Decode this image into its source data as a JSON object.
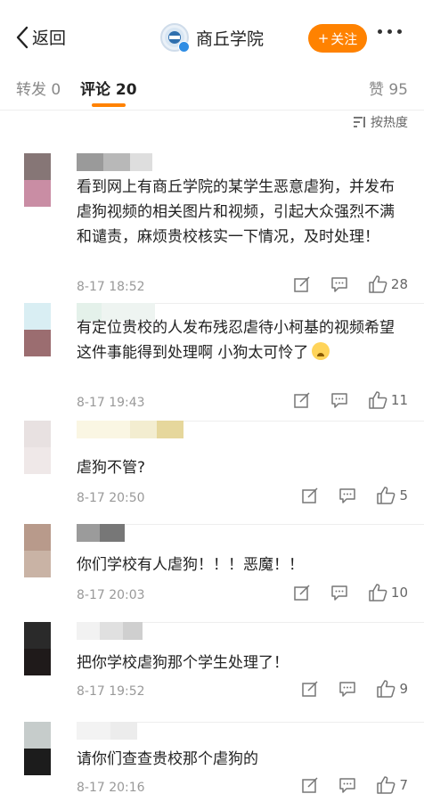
{
  "nav": {
    "back_label": "返回",
    "account_name": "商丘学院",
    "follow_label": "关注",
    "follow_plus": "+",
    "accent_color": "#ff8200"
  },
  "tabs": {
    "repost": "转发 0",
    "comment": "评论 20",
    "like": "赞 95"
  },
  "sort": {
    "label": "按热度",
    "icon": "sort-icon"
  },
  "comments": [
    {
      "text": "看到网上有商丘学院的某学生恶意虐狗，并发布虐狗视频的相关图片和视频，引起大众强烈不满和谴责，麻烦贵校核实一下情况，及时处理！",
      "time": "8-17 18:52",
      "likes": "28",
      "avatar_colors": [
        "#867676",
        "#c98da4"
      ],
      "name_colors": [
        "#9a9a9a",
        "#b8b8b8",
        "#dedede"
      ]
    },
    {
      "text": "有定位贵校的人发布残忍虐待小柯基的视频希望这件事能得到处理啊 小狗太可怜了",
      "time": "8-17 19:43",
      "likes": "11",
      "avatar_colors": [
        "#d9eef3",
        "#9b6d70"
      ],
      "name_colors": [
        "#e4f1ea",
        "#eef4f1"
      ]
    },
    {
      "text": "虐狗不管?",
      "time": "8-17 20:50",
      "likes": "5",
      "avatar_colors": [
        "#e8e1e1",
        "#efe8e8"
      ],
      "name_colors": [
        "#faf6e3",
        "#f3edd0",
        "#e6d79c"
      ]
    },
    {
      "text": "你们学校有人虐狗！！！恶魔！！",
      "time": "8-17 20:03",
      "likes": "10",
      "avatar_colors": [
        "#b89a8b",
        "#c9b3a5"
      ],
      "name_colors": [
        "#9b9b9b",
        "#777777"
      ]
    },
    {
      "text": "把你学校虐狗那个学生处理了！",
      "time": "8-17 19:52",
      "likes": "9",
      "avatar_colors": [
        "#2a2a2a",
        "#1f1a1a"
      ],
      "name_colors": [
        "#f2f2f2",
        "#e0e0e0",
        "#cfcfcf"
      ]
    },
    {
      "text": "请你们查查贵校那个虐狗的",
      "time": "8-17 20:16",
      "likes": "7",
      "avatar_colors": [
        "#c6cccb",
        "#1c1c1c"
      ],
      "name_colors": [
        "#f3f3f3",
        "#ececec"
      ]
    }
  ]
}
